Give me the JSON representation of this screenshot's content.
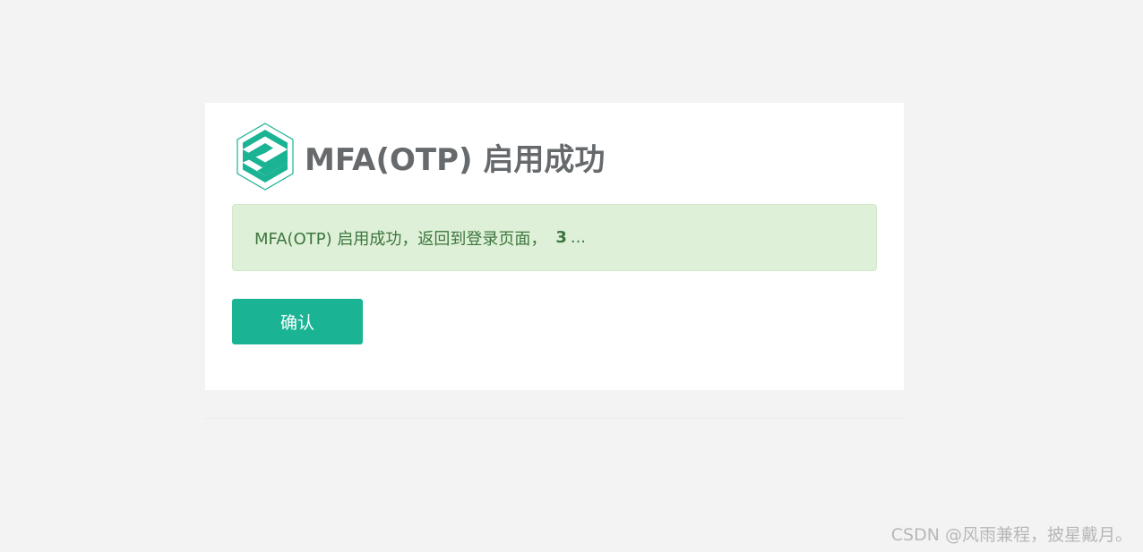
{
  "header": {
    "title": "MFA(OTP) 启用成功",
    "logo_icon": "brand-hexagon-logo"
  },
  "alert": {
    "message": "MFA(OTP) 启用成功，返回到登录页面，",
    "countdown": "3",
    "ellipsis": "..."
  },
  "actions": {
    "confirm_label": "确认"
  },
  "watermark": {
    "text": "CSDN @风雨兼程，披星戴月。"
  },
  "colors": {
    "page_background": "#f3f3f4",
    "card_background": "#ffffff",
    "alert_background": "#dff0d8",
    "alert_text": "#3c763d",
    "button_background": "#1ab394",
    "title_text": "#676a6c"
  }
}
